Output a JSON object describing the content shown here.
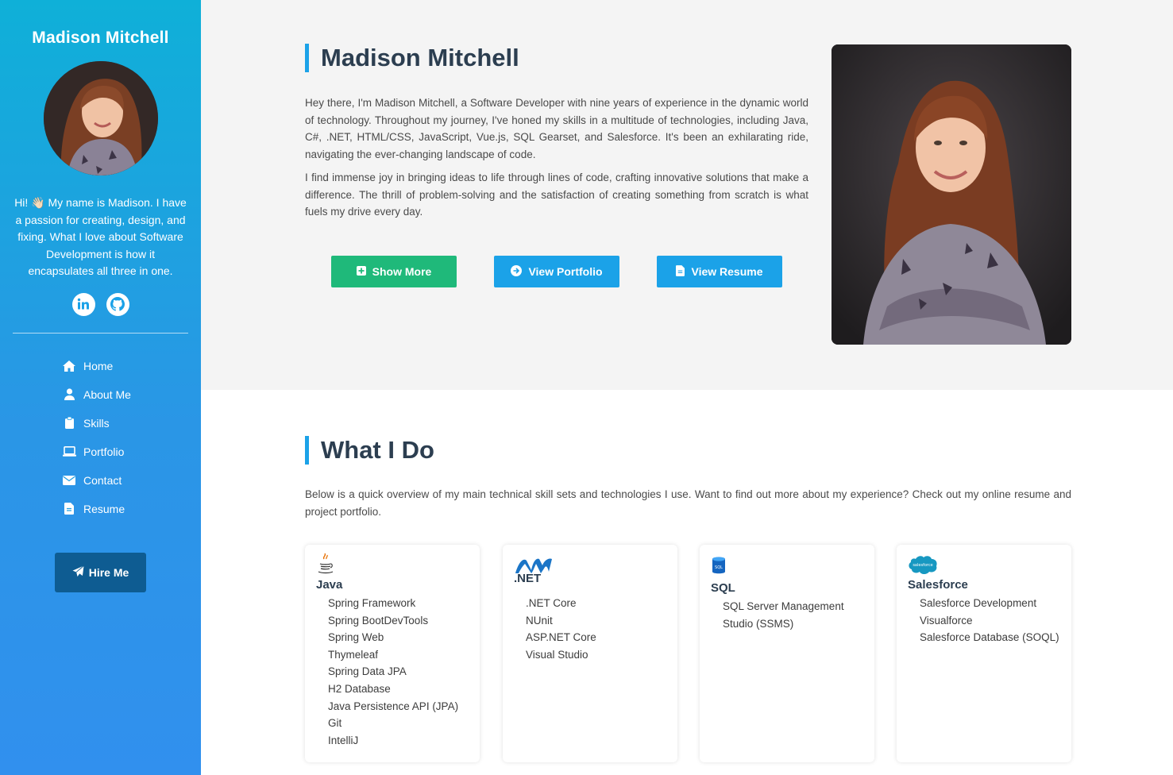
{
  "sidebar": {
    "name": "Madison Mitchell",
    "bio": "Hi! 👋🏻 My name is Madison. I have a passion for creating, design, and fixing. What I love about Software Development is how it encapsulates all three in one.",
    "social": [
      {
        "icon": "linkedin-icon"
      },
      {
        "icon": "github-icon"
      }
    ],
    "nav": [
      {
        "label": "Home",
        "icon": "home-icon"
      },
      {
        "label": "About Me",
        "icon": "user-icon"
      },
      {
        "label": "Skills",
        "icon": "clipboard-icon"
      },
      {
        "label": "Portfolio",
        "icon": "laptop-icon"
      },
      {
        "label": "Contact",
        "icon": "envelope-icon"
      },
      {
        "label": "Resume",
        "icon": "file-icon"
      }
    ],
    "hire_label": "Hire Me"
  },
  "hero": {
    "title": "Madison Mitchell",
    "paragraph1": "Hey there, I'm Madison Mitchell, a Software Developer with nine years of experience in the dynamic world of technology. Throughout my journey, I've honed my skills in a multitude of technologies, including Java, C#, .NET, HTML/CSS, JavaScript, Vue.js, SQL Gearset, and Salesforce. It's been an exhilarating ride, navigating the ever-changing landscape of code.",
    "paragraph2": "I find immense joy in bringing ideas to life through lines of code, crafting innovative solutions that make a difference. The thrill of problem-solving and the satisfaction of creating something from scratch is what fuels my drive every day.",
    "buttons": {
      "show_more": "Show More",
      "view_portfolio": "View Portfolio",
      "view_resume": "View Resume"
    }
  },
  "whatido": {
    "title": "What I Do",
    "intro": "Below is a quick overview of my main technical skill sets and technologies I use. Want to find out more about my experience? Check out my online resume and project portfolio.",
    "cards": [
      {
        "title": "Java",
        "icon": "java-icon",
        "items": [
          "Spring Framework",
          "Spring BootDevTools",
          "Spring Web",
          "Thymeleaf",
          "Spring Data JPA",
          "H2 Database",
          "Java Persistence API (JPA)",
          "Git",
          "IntelliJ"
        ]
      },
      {
        "title": ".NET",
        "icon": "dotnet-icon",
        "items": [
          ".NET Core",
          "NUnit",
          "ASP.NET Core",
          "Visual Studio"
        ]
      },
      {
        "title": "SQL",
        "icon": "sql-icon",
        "items": [
          "SQL Server Management Studio (SSMS)"
        ]
      },
      {
        "title": "Salesforce",
        "icon": "salesforce-icon",
        "logo_text": "salesforce",
        "items": [
          "Salesforce Development",
          "Visualforce",
          "Salesforce Database (SOQL)"
        ]
      }
    ]
  },
  "colors": {
    "accent": "#1ba2e8",
    "green": "#1fb97a",
    "hire_button": "#0e5c92",
    "heading": "#2c3e50"
  }
}
